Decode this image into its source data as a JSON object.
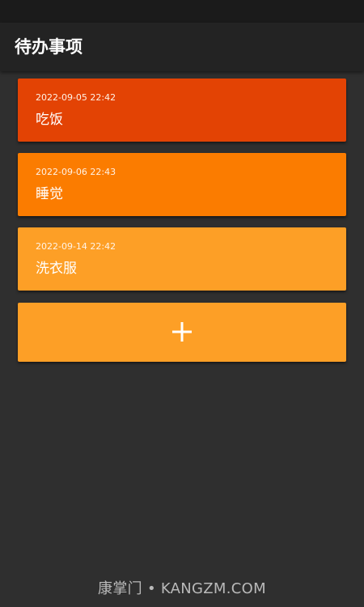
{
  "app_bar": {
    "title": "待办事项"
  },
  "todos": [
    {
      "date": "2022-09-05 22:42",
      "text": "吃饭",
      "color": "#e34304"
    },
    {
      "date": "2022-09-06 22:43",
      "text": "睡觉",
      "color": "#fb7c00"
    },
    {
      "date": "2022-09-14 22:42",
      "text": "洗衣服",
      "color": "#fd9f26"
    }
  ],
  "add_button": {
    "icon": "plus-icon",
    "color": "#fd9f26"
  },
  "watermark": "康掌门 • KANGZM.COM"
}
